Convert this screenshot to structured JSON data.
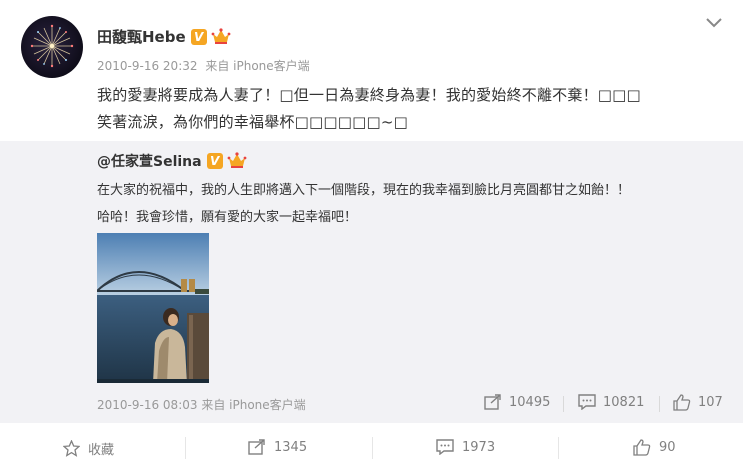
{
  "post": {
    "author": "田馥甄Hebe",
    "verified_badge": "V",
    "timestamp": "2010-9-16 20:32",
    "source": "来自 iPhone客户端",
    "text_line1": "我的愛妻將要成為人妻了！□但一日為妻終身為妻！我的愛始終不離不棄！□□□",
    "text_line2": "笑著流淚，為你們的幸福舉杯□□□□□□~□"
  },
  "repost": {
    "author": "@任家萱Selina",
    "verified_badge": "V",
    "text_line1": "在大家的祝福中，我的人生即將邁入下一個階段，現在的我幸福到臉比月亮圓都甘之如飴！！",
    "text_line2": "哈哈！我會珍惜，願有愛的大家一起幸福吧！",
    "timestamp": "2010-9-16 08:03",
    "source": "来自 iPhone客户端",
    "stats": {
      "reposts": "10495",
      "comments": "10821",
      "likes": "107"
    }
  },
  "footer": {
    "favorite_label": "收藏",
    "repost_count": "1345",
    "comment_count": "1973",
    "like_count": "90"
  },
  "icons": [
    "chevron-down-icon",
    "crown-icon",
    "share-icon",
    "comment-icon",
    "thumbs-up-icon",
    "star-icon"
  ],
  "colors": {
    "accent_orange": "#f5a623",
    "muted_text": "#999999",
    "repost_bg": "#f2f2f5"
  }
}
